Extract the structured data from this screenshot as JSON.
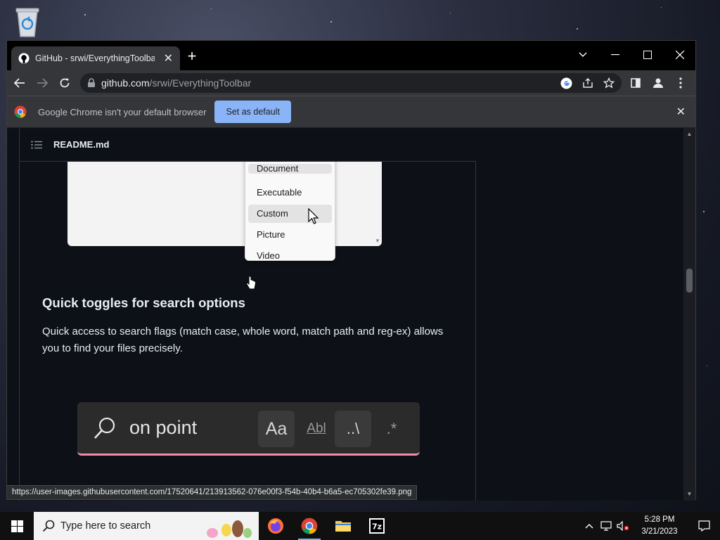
{
  "browser": {
    "tab_title": "GitHub - srwi/EverythingToolbar",
    "new_tab_label": "+",
    "url_host": "github.com",
    "url_path": "/srwi/EverythingToolbar"
  },
  "infobar": {
    "message": "Google Chrome isn't your default browser",
    "button": "Set as default"
  },
  "readme": {
    "file_name": "README.md",
    "filter_menu": [
      "Document",
      "Executable",
      "Custom",
      "Picture",
      "Video"
    ],
    "highlighted": "Custom",
    "heading": "Quick toggles for search options",
    "paragraph": "Quick access to search flags (match case, whole word, match path and reg-ex) allows you to find your files precisely.",
    "search_demo": {
      "query": "on point",
      "toggles": [
        "Aa",
        "Abl",
        "..\\",
        ".*"
      ]
    }
  },
  "status_url": "https://user-images.githubusercontent.com/17520641/213913562-076e00f3-f54b-40b4-b6a5-ec705302fe39.png",
  "taskbar": {
    "search_placeholder": "Type here to search",
    "time": "5:28 PM",
    "date": "3/21/2023"
  },
  "colors": {
    "accent_blue": "#8ab4f8",
    "page_bg": "#0d1117",
    "search_underline": "#f38ba8"
  }
}
